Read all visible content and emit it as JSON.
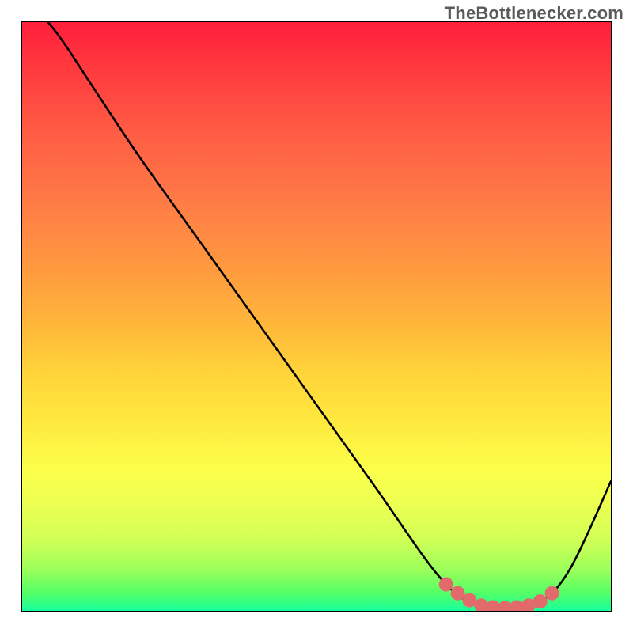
{
  "watermark": "TheBottlenecker.com",
  "colors": {
    "curve": "#000000",
    "marker": "#e26a6a"
  },
  "chart_data": {
    "type": "line",
    "title": "",
    "xlabel": "",
    "ylabel": "",
    "xlim": [
      0,
      100
    ],
    "ylim": [
      0,
      100
    ],
    "grid": false,
    "legend": false,
    "description": "Bottleneck curve: y is mismatch percentage (0 = optimal, 100 = worst). Valley (y≈0) marks the optimal zone, rendered with salmon markers.",
    "series": [
      {
        "name": "bottleneck_curve",
        "x": [
          0,
          6,
          12,
          20,
          30,
          40,
          50,
          60,
          68,
          72,
          75,
          78,
          81,
          84,
          87,
          90,
          93,
          96,
          100
        ],
        "y": [
          105,
          98,
          89,
          77,
          63,
          49,
          35,
          21,
          9.5,
          4.5,
          2.0,
          0.9,
          0.5,
          0.6,
          1.2,
          3.0,
          7.0,
          13,
          22
        ]
      }
    ],
    "markers": {
      "name": "optimal_zone",
      "x": [
        72,
        74,
        76,
        78,
        80,
        82,
        84,
        86,
        88,
        90
      ],
      "y": [
        4.5,
        3.0,
        1.8,
        0.9,
        0.6,
        0.5,
        0.6,
        0.9,
        1.6,
        3.0
      ],
      "size": 9
    },
    "gradient_stops": [
      {
        "pos": 0.0,
        "color": "#ff1f3c"
      },
      {
        "pos": 0.5,
        "color": "#ffbc3a"
      },
      {
        "pos": 0.78,
        "color": "#f9ff4c"
      },
      {
        "pos": 1.0,
        "color": "#17ff9c"
      }
    ]
  }
}
